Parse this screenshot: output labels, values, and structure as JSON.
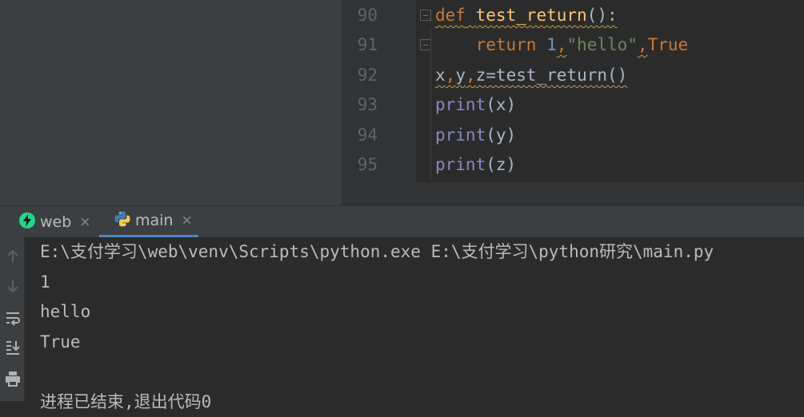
{
  "editor": {
    "line_numbers": [
      "90",
      "91",
      "92",
      "93",
      "94",
      "95"
    ],
    "lines": {
      "l90": {
        "kw": "def",
        "sp": " ",
        "fn": "test_return",
        "rest": "():"
      },
      "l91": {
        "indent": "    ",
        "kw": "return",
        "sp": " ",
        "num": "1",
        "c1": ",",
        "str": "\"hello\"",
        "c2": ",",
        "kw2": "True"
      },
      "l92": {
        "a": "x",
        "c1": ",",
        "b": "y",
        "c2": ",",
        "c": "z",
        "rest": "=test_return()"
      },
      "l93": {
        "fn": "print",
        "args": "(x)"
      },
      "l94": {
        "fn": "print",
        "args": "(y)"
      },
      "l95": {
        "fn": "print",
        "args": "(z)"
      }
    }
  },
  "run_panel": {
    "tabs": [
      {
        "label": "web",
        "icon": "pycharm-icon"
      },
      {
        "label": "main",
        "icon": "python-icon"
      }
    ],
    "close_glyph": "×",
    "toolbar_icons": [
      "up-arrow-icon",
      "down-arrow-icon",
      "soft-wrap-icon",
      "scroll-to-end-icon",
      "print-icon"
    ]
  },
  "console": {
    "lines": [
      "E:\\支付学习\\web\\venv\\Scripts\\python.exe E:\\支付学习\\python研究\\main.py",
      "1",
      "hello",
      "True",
      "",
      "进程已结束,退出代码0"
    ]
  },
  "colors": {
    "keyword": "#cc7832",
    "function": "#ffc66d",
    "number": "#6897bb",
    "string": "#6a8759",
    "builtin": "#8888c6",
    "text": "#a9b7c6",
    "console_text": "#bbbbbb",
    "tab_underline": "#4a88c7"
  }
}
